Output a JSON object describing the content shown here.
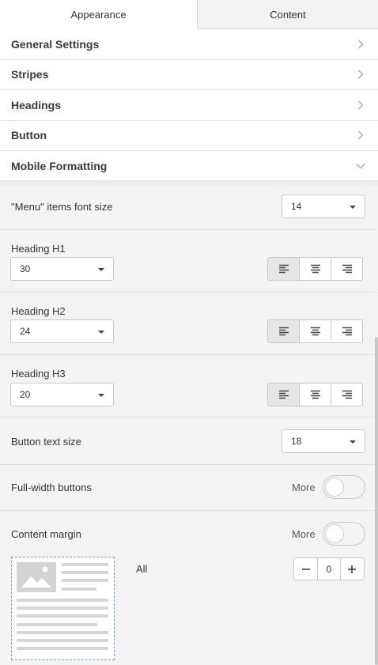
{
  "tabs": [
    {
      "label": "Appearance",
      "active": true
    },
    {
      "label": "Content",
      "active": false
    }
  ],
  "accordion": {
    "items": [
      {
        "label": "General Settings",
        "icon": "chevron-right-icon"
      },
      {
        "label": "Stripes",
        "icon": "chevron-right-icon"
      },
      {
        "label": "Headings",
        "icon": "chevron-right-icon"
      },
      {
        "label": "Button",
        "icon": "chevron-right-icon"
      },
      {
        "label": "Mobile Formatting",
        "icon": "chevron-down-icon"
      }
    ]
  },
  "mobile": {
    "menu_font": {
      "label": "\"Menu\" items font size",
      "value": "14"
    },
    "h1": {
      "label": "Heading H1",
      "value": "30",
      "align": "left"
    },
    "h2": {
      "label": "Heading H2",
      "value": "24",
      "align": "left"
    },
    "h3": {
      "label": "Heading H3",
      "value": "20",
      "align": "left"
    },
    "button_text": {
      "label": "Button text size",
      "value": "18"
    },
    "full_width": {
      "label": "Full-width buttons",
      "more": "More",
      "on": false
    },
    "content_margin": {
      "label": "Content margin",
      "more": "More",
      "on": false,
      "all_label": "All",
      "value": "0"
    }
  },
  "colors": {
    "accent_border": "#6a9fd8",
    "active_align_bg": "#e6e6e6"
  }
}
